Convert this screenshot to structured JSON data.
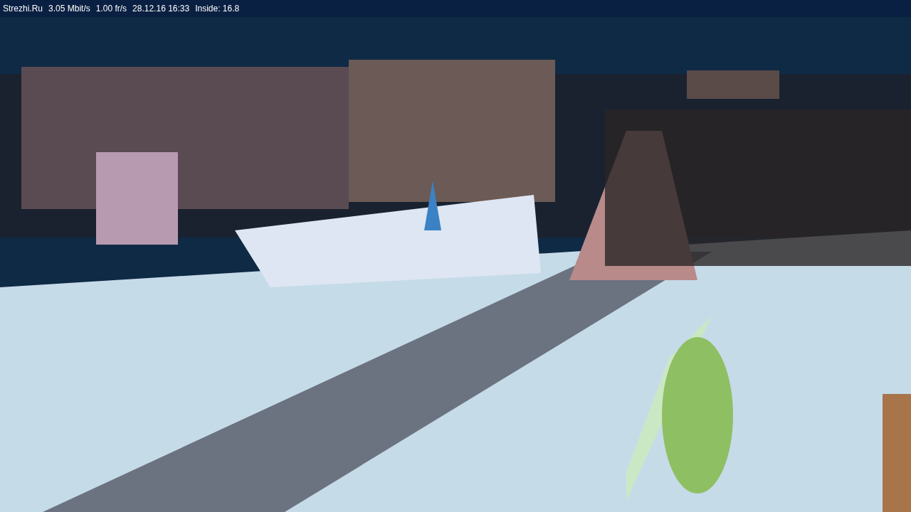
{
  "status_bar": {
    "items": [
      "Strezhi.Ru",
      "3.05 Mbit/s",
      "1.00 fr/s",
      "28.12.16 16:33",
      "Inside: 16.8"
    ]
  }
}
